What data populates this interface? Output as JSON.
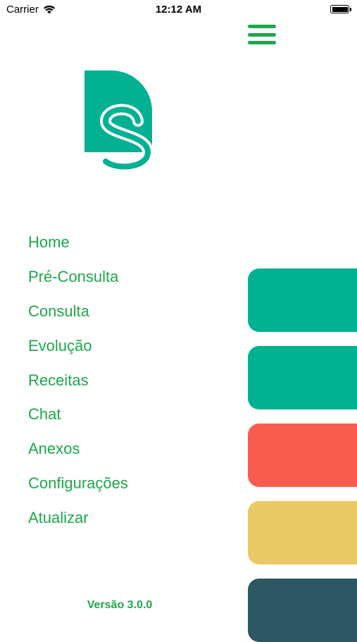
{
  "status_bar": {
    "carrier": "Carrier",
    "time": "12:12 AM",
    "wifi_icon": "wifi-icon",
    "battery_icon": "battery-full-icon"
  },
  "header": {
    "menu_icon": "hamburger-menu-icon",
    "logo": "ds-logo"
  },
  "menu": {
    "items": [
      {
        "label": "Home"
      },
      {
        "label": "Pré-Consulta"
      },
      {
        "label": "Consulta"
      },
      {
        "label": "Evolução"
      },
      {
        "label": "Receitas"
      },
      {
        "label": "Chat"
      },
      {
        "label": "Anexos"
      },
      {
        "label": "Configurações"
      },
      {
        "label": "Atualizar"
      }
    ]
  },
  "footer": {
    "version": "Versão 3.0.0"
  },
  "background_cards": [
    {
      "color": "#02b092"
    },
    {
      "color": "#02b092"
    },
    {
      "color": "#f95d4f"
    },
    {
      "color": "#eaca67"
    },
    {
      "color": "#2d5763"
    }
  ],
  "colors": {
    "accent_green": "#1fa64b",
    "logo_teal": "#02b092",
    "background": "#ffffff"
  }
}
